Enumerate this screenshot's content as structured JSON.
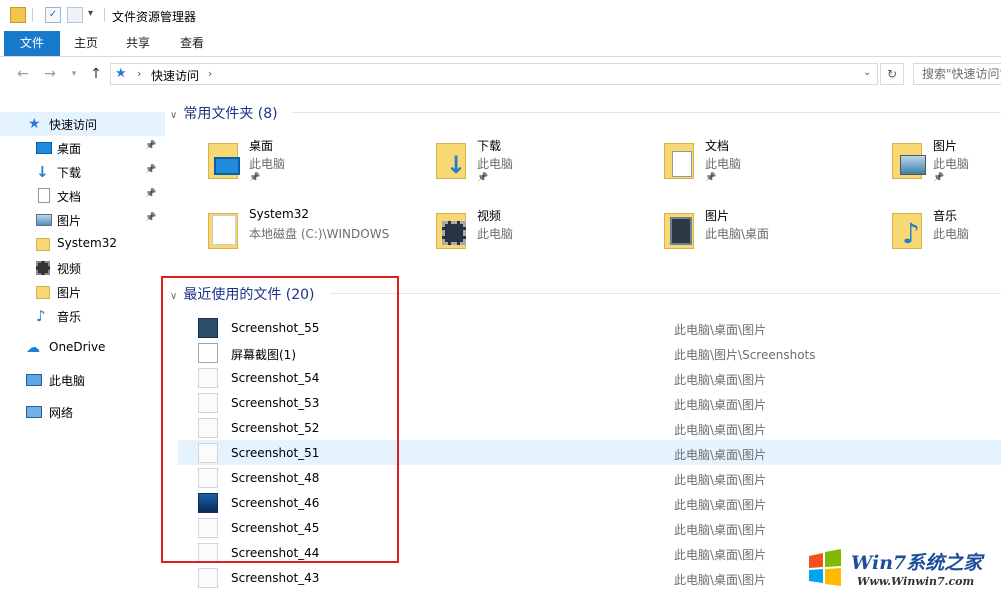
{
  "window": {
    "title": "文件资源管理器"
  },
  "ribbon": {
    "tabs": [
      "文件",
      "主页",
      "共享",
      "查看"
    ]
  },
  "address": {
    "breadcrumb": "快速访问",
    "search_placeholder": "搜索\"快速访问\""
  },
  "nav": {
    "items": [
      {
        "label": "快速访问",
        "icon": "star-icon",
        "pinned": false,
        "selected": true
      },
      {
        "label": "桌面",
        "icon": "desktop-icon",
        "pinned": true
      },
      {
        "label": "下载",
        "icon": "download-icon",
        "pinned": true
      },
      {
        "label": "文档",
        "icon": "document-icon",
        "pinned": true
      },
      {
        "label": "图片",
        "icon": "picture-icon",
        "pinned": true
      },
      {
        "label": "System32",
        "icon": "folder-icon",
        "pinned": false
      },
      {
        "label": "视频",
        "icon": "video-icon",
        "pinned": false
      },
      {
        "label": "图片",
        "icon": "folder-icon",
        "pinned": false
      },
      {
        "label": "音乐",
        "icon": "music-icon",
        "pinned": false
      },
      {
        "label": "OneDrive",
        "icon": "cloud-icon",
        "pinned": false
      },
      {
        "label": "此电脑",
        "icon": "computer-icon",
        "pinned": false
      },
      {
        "label": "网络",
        "icon": "network-icon",
        "pinned": false
      }
    ]
  },
  "frequent": {
    "header": "常用文件夹 (8)",
    "folders": [
      {
        "name": "桌面",
        "sub": "此电脑",
        "pinned": true,
        "badge": "desktop"
      },
      {
        "name": "下载",
        "sub": "此电脑",
        "pinned": true,
        "badge": "download"
      },
      {
        "name": "文档",
        "sub": "此电脑",
        "pinned": true,
        "badge": "document"
      },
      {
        "name": "图片",
        "sub": "此电脑",
        "pinned": true,
        "badge": "picture"
      },
      {
        "name": "System32",
        "sub": "本地磁盘 (C:)\\WINDOWS",
        "pinned": false,
        "badge": "system"
      },
      {
        "name": "视频",
        "sub": "此电脑",
        "pinned": false,
        "badge": "video"
      },
      {
        "name": "图片",
        "sub": "此电脑\\桌面",
        "pinned": false,
        "badge": "photo"
      },
      {
        "name": "音乐",
        "sub": "此电脑",
        "pinned": false,
        "badge": "music"
      }
    ]
  },
  "recent": {
    "header": "最近使用的文件 (20)",
    "files": [
      {
        "name": "Screenshot_55",
        "location": "此电脑\\桌面\\图片"
      },
      {
        "name": "屏幕截图(1)",
        "location": "此电脑\\图片\\Screenshots"
      },
      {
        "name": "Screenshot_54",
        "location": "此电脑\\桌面\\图片"
      },
      {
        "name": "Screenshot_53",
        "location": "此电脑\\桌面\\图片"
      },
      {
        "name": "Screenshot_52",
        "location": "此电脑\\桌面\\图片"
      },
      {
        "name": "Screenshot_51",
        "location": "此电脑\\桌面\\图片",
        "highlighted": true
      },
      {
        "name": "Screenshot_48",
        "location": "此电脑\\桌面\\图片"
      },
      {
        "name": "Screenshot_46",
        "location": "此电脑\\桌面\\图片"
      },
      {
        "name": "Screenshot_45",
        "location": "此电脑\\桌面\\图片"
      },
      {
        "name": "Screenshot_44",
        "location": "此电脑\\桌面\\图片"
      },
      {
        "name": "Screenshot_43",
        "location": "此电脑\\桌面\\图片"
      }
    ]
  },
  "watermark": {
    "brand": "Win7系统之家",
    "url": "Www.Winwin7.com"
  },
  "colors": {
    "accent": "#1979ca",
    "selection": "#e5f3ff",
    "highlight_box": "#e02020",
    "group_header": "#1e3287"
  }
}
